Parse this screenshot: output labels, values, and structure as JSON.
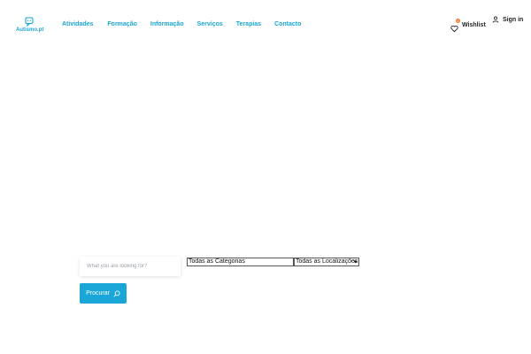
{
  "brand": {
    "name": "Autismo.pt",
    "color": "#1aa6d6",
    "icon": "chat-bubble-logo"
  },
  "nav": {
    "items": [
      {
        "label": "Atividades"
      },
      {
        "label": "Formação"
      },
      {
        "label": "Informação"
      },
      {
        "label": "Serviços"
      },
      {
        "label": "Terapias"
      },
      {
        "label": "Contacto"
      }
    ]
  },
  "header_actions": {
    "wishlist": {
      "label": "Wishlist",
      "count": "0",
      "icon": "heart-icon",
      "badge_color": "#f07b2c"
    },
    "signin": {
      "label": "Sign in",
      "icon": "user-icon"
    }
  },
  "search": {
    "placeholder": "What you are looking for?",
    "category_select": {
      "selected": "Todas as Categorias"
    },
    "location_select": {
      "selected": "Todas as Localizações"
    },
    "submit": {
      "label": "Procurar",
      "icon": "search-icon"
    }
  }
}
